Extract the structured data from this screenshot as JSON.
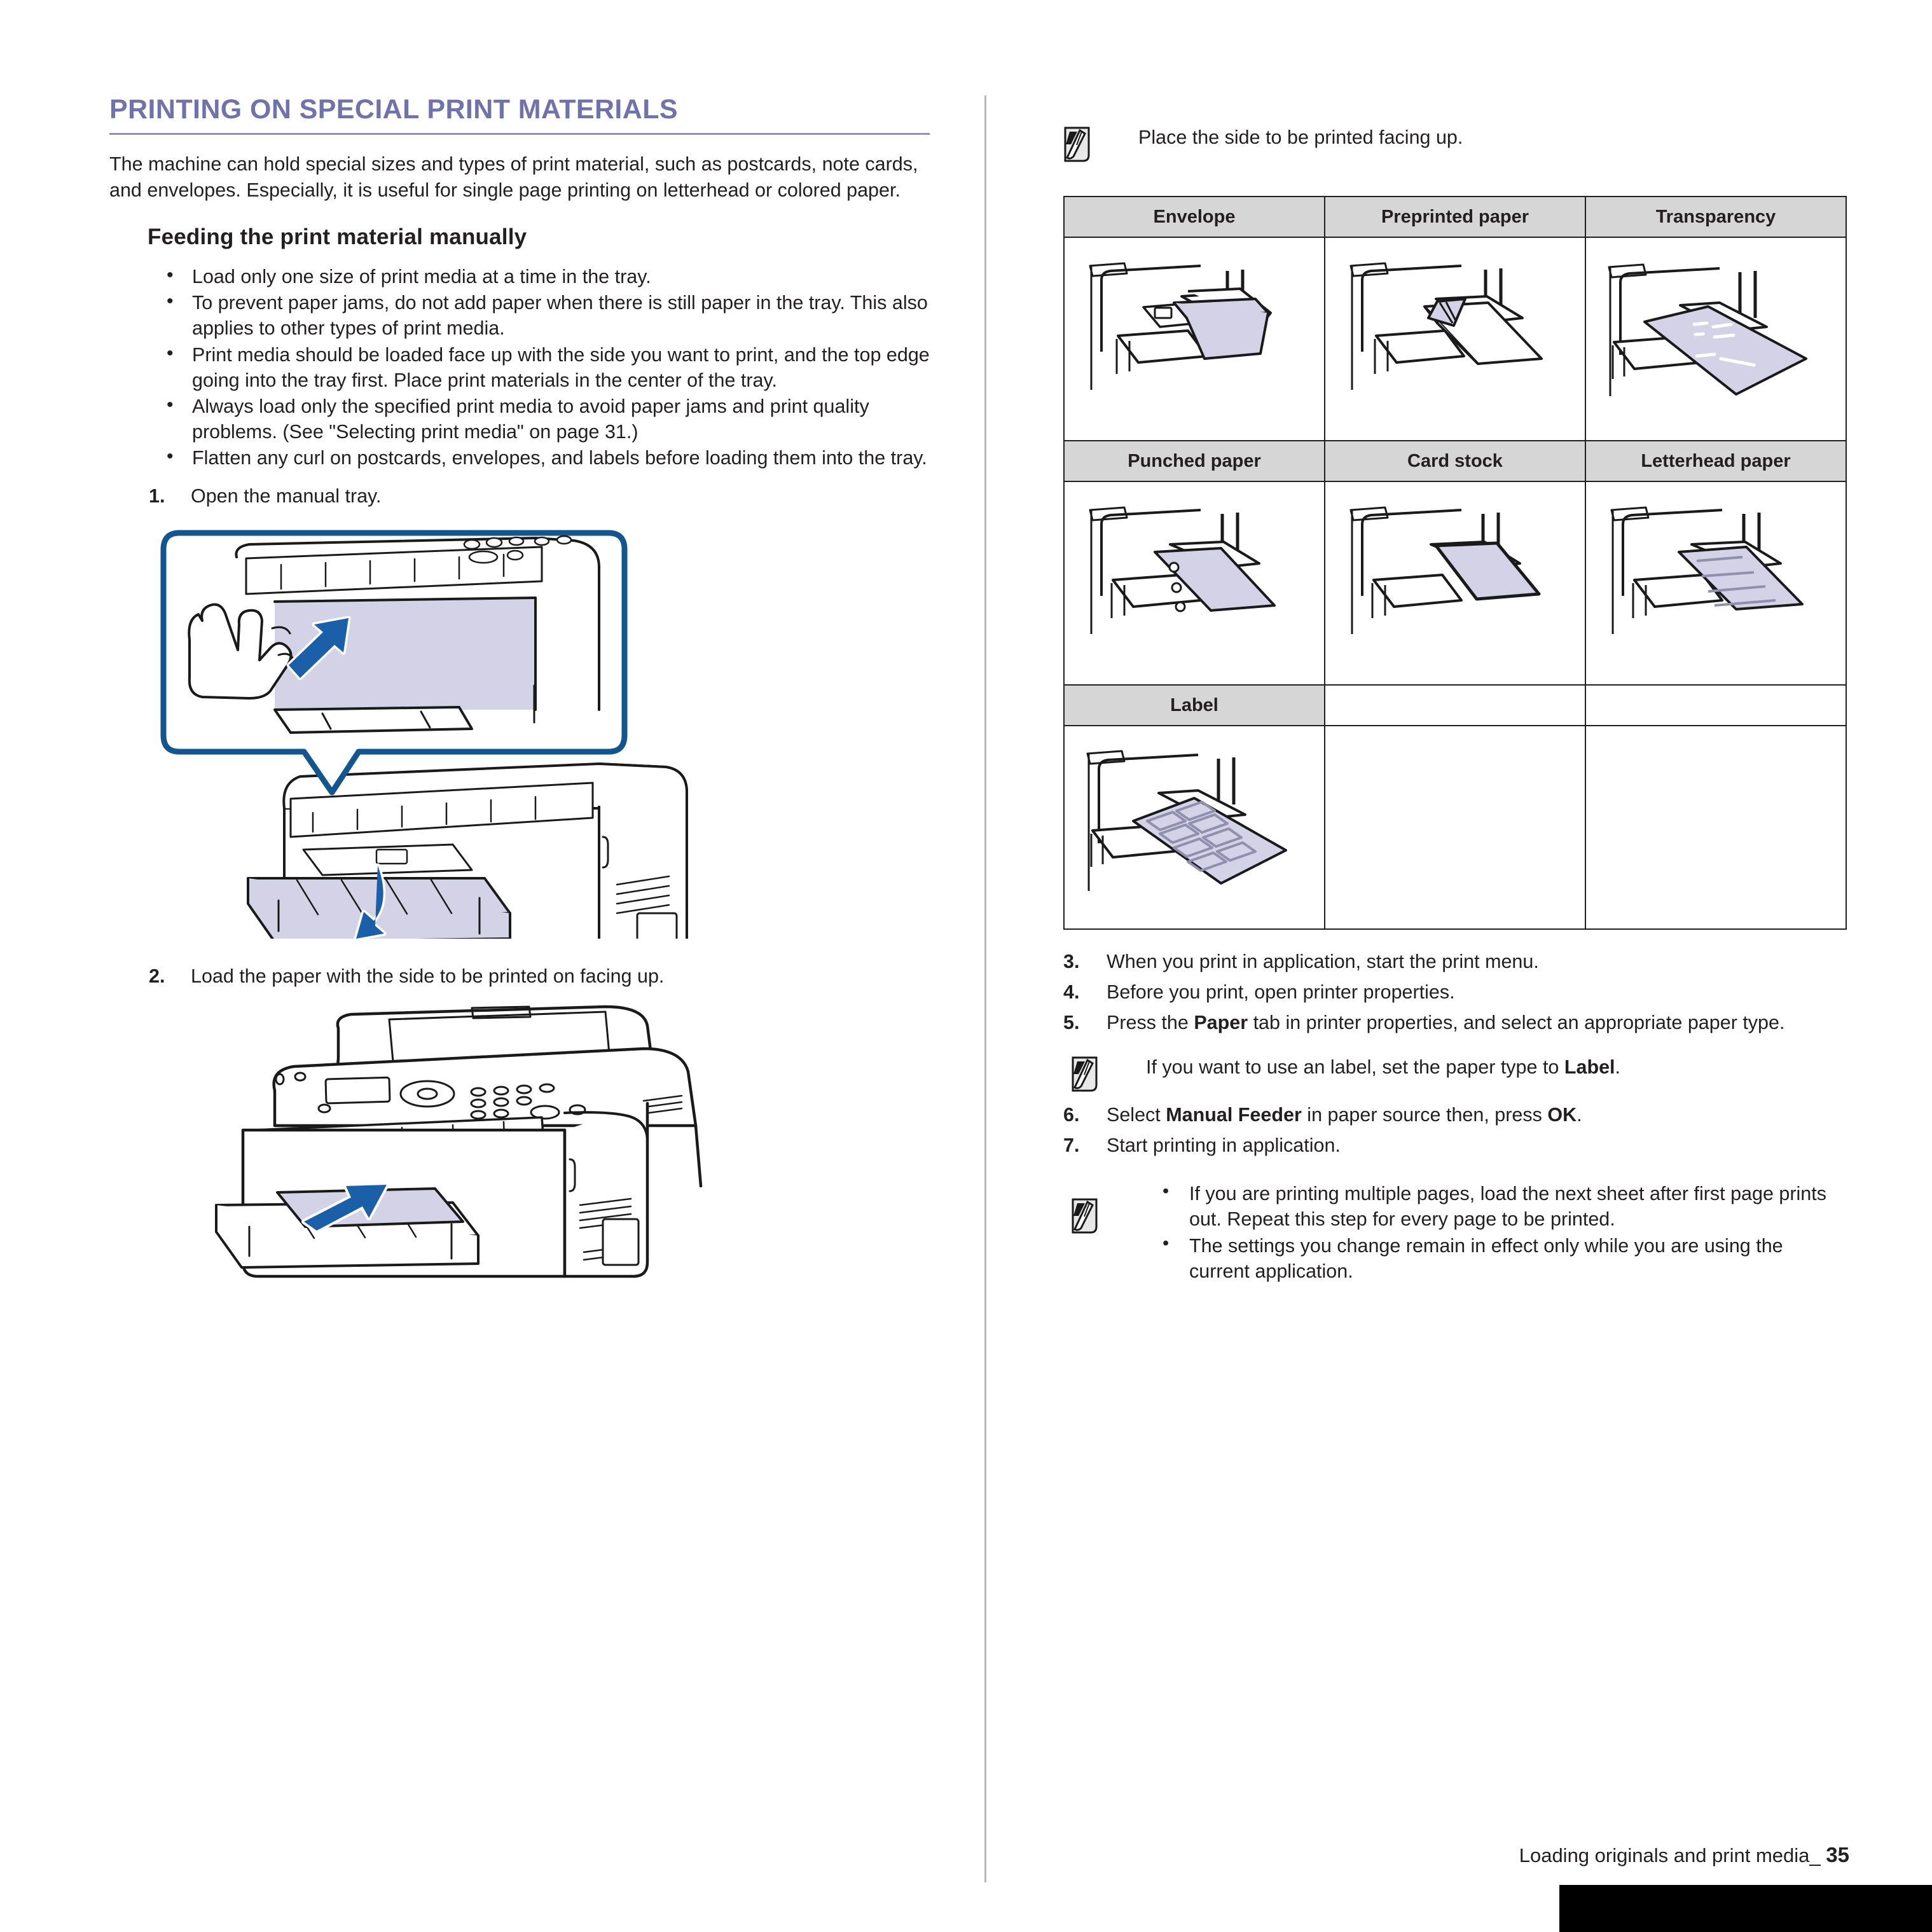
{
  "section": {
    "title": "PRINTING ON SPECIAL PRINT MATERIALS",
    "accent_color": "#6f72ab",
    "intro": "The machine can hold special sizes and types of print material, such as postcards, note cards, and envelopes. Especially, it is useful for single page printing on letterhead or colored paper.",
    "subsection_title": "Feeding the print material manually"
  },
  "bullets": [
    "Load only one size of print media at a time in the tray.",
    "To prevent paper jams, do not add paper when there is still paper in the tray. This also applies to other types of print media.",
    "Print media should be loaded face up with the side you want to print, and the top edge going into the tray first. Place print materials in the center of the tray.",
    "Always load only the specified print media to avoid paper jams and print quality problems. (See \"Selecting print media\" on page 31.)",
    "Flatten any curl on postcards, envelopes, and labels before loading them into the tray."
  ],
  "steps_left": [
    {
      "num": "1.",
      "text": "Open the manual tray."
    },
    {
      "num": "2.",
      "text": "Load the paper with the side to be printed on facing up."
    }
  ],
  "figures": {
    "fig1_name": "printer-open-manual-tray-illustration",
    "fig2_name": "printer-load-paper-illustration"
  },
  "right_note_top": {
    "icon": "note-icon",
    "text": "Place the side to be printed facing up."
  },
  "media_table": {
    "rows": [
      {
        "headers": [
          "Envelope",
          "Preprinted paper",
          "Transparency"
        ],
        "images": [
          "envelope-in-tray-illustration",
          "preprinted-paper-in-tray-illustration",
          "transparency-in-tray-illustration"
        ]
      },
      {
        "headers": [
          "Punched paper",
          "Card stock",
          "Letterhead paper"
        ],
        "images": [
          "punched-paper-in-tray-illustration",
          "card-stock-in-tray-illustration",
          "letterhead-paper-in-tray-illustration"
        ]
      },
      {
        "headers": [
          "Label",
          "",
          ""
        ],
        "images": [
          "label-sheet-in-tray-illustration",
          "",
          ""
        ]
      }
    ]
  },
  "steps_right": [
    {
      "num": "3.",
      "pre": "When you print in application, start the print menu.",
      "bold": "",
      "post": ""
    },
    {
      "num": "4.",
      "pre": "Before you print, open printer properties.",
      "bold": "",
      "post": ""
    },
    {
      "num": "5.",
      "pre": "Press the ",
      "bold": "Paper",
      "post": " tab in printer properties, and select an appropriate paper type."
    }
  ],
  "note_label": {
    "pre": "If you want to use an label, set the paper type to ",
    "bold": "Label",
    "post": "."
  },
  "steps_right2": [
    {
      "num": "6.",
      "pre": "Select ",
      "bold": "Manual Feeder",
      "mid": " in paper source then, press ",
      "bold2": "OK",
      "post": "."
    },
    {
      "num": "7.",
      "pre": "Start printing in application.",
      "bold": "",
      "mid": "",
      "bold2": "",
      "post": ""
    }
  ],
  "note_bottom_bullets": [
    "If you are printing multiple pages, load the next sheet after first page prints out. Repeat this step for every page to be printed.",
    "The settings you change remain in effect only while you are using the current application."
  ],
  "footer": {
    "text": "Loading originals and print media_",
    "page": "35"
  }
}
